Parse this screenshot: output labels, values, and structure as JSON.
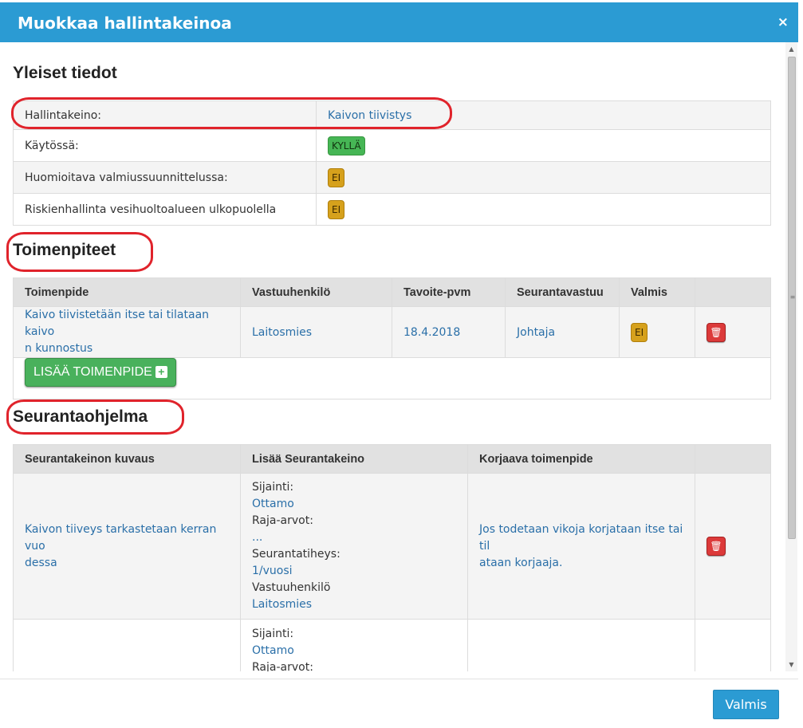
{
  "modal": {
    "title": "Muokkaa hallintakeinoa",
    "close_label": "×"
  },
  "general": {
    "heading": "Yleiset tiedot",
    "rows": [
      {
        "label": "Hallintakeino:",
        "value": "Kaivon tiivistys"
      },
      {
        "label": "Käytössä:",
        "value": "KYLLÄ"
      },
      {
        "label": "Huomioitava valmiussuunnittelussa:",
        "value": "EI"
      },
      {
        "label": "Riskienhallinta vesihuoltoalueen ulkopuolella",
        "value": "EI"
      }
    ]
  },
  "actions": {
    "heading": "Toimenpiteet",
    "columns": [
      "Toimenpide",
      "Vastuuhenkilö",
      "Tavoite-pvm",
      "Seurantavastuu",
      "Valmis",
      ""
    ],
    "rows": [
      {
        "action": "Kaivo tiivistetään itse tai tilataan kaivon kunnostus",
        "action_line1": "Kaivo tiivistetään itse tai tilataan kaivo",
        "action_line2": "n kunnostus",
        "responsible": "Laitosmies",
        "target_date": "18.4.2018",
        "follow_up": "Johtaja",
        "done": "EI"
      }
    ],
    "add_button": "LISÄÄ TOIMENPIDE"
  },
  "monitoring": {
    "heading": "Seurantaohjelma",
    "columns": [
      "Seurantakeinon kuvaus",
      "Lisää Seurantakeino",
      "Korjaava toimenpide",
      ""
    ],
    "rows": [
      {
        "description_line1": "Kaivon tiiveys tarkastetaan kerran vuo",
        "description_line2": "dessa",
        "location_label": "Sijainti:",
        "location": "Ottamo",
        "limits_label": "Raja-arvot:",
        "limits": "...",
        "frequency_label": "Seurantatiheys:",
        "frequency": "1/vuosi",
        "responsible_label": "Vastuuhenkilö",
        "responsible": "Laitosmies",
        "corrective_line1": "Jos todetaan vikoja korjataan itse tai til",
        "corrective_line2": "ataan korjaaja."
      },
      {
        "location_label": "Sijainti:",
        "location": "Ottamo",
        "limits_label": "Raja-arvot:"
      }
    ]
  },
  "footer": {
    "done_button": "Valmis"
  },
  "colors": {
    "header": "#2b9bd3",
    "badge_yes": "#46b655",
    "badge_no": "#d6a11c",
    "delete": "#dc3a3a",
    "add": "#49b15c",
    "annotation": "#e0232b"
  }
}
